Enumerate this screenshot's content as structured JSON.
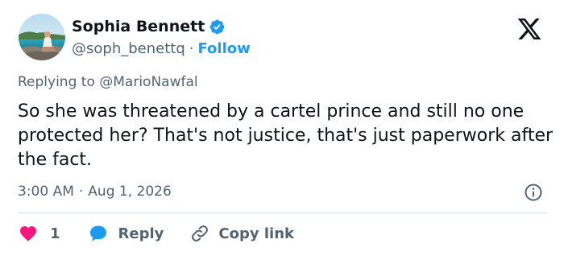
{
  "author": {
    "name": "Sophia Bennett",
    "handle": "@soph_benettq",
    "separator": "·",
    "follow_label": "Follow",
    "avatar_icon": "beach-photo-avatar",
    "verified_icon": "verified-badge-icon"
  },
  "brand": {
    "logo_icon": "x-logo-icon"
  },
  "reply_context": {
    "prefix": "Replying to",
    "mention": "@MarioNawfal"
  },
  "post": {
    "text": "So she was threatened by a cartel prince and still no one protected her? That's not justice, that's just paperwork after the fact.",
    "time": "3:00 AM",
    "separator": "·",
    "date": "Aug 1, 2026"
  },
  "actions": {
    "like_count": "1",
    "reply_label": "Reply",
    "copy_label": "Copy link"
  },
  "colors": {
    "accent": "#1d9bf0",
    "like": "#f91880",
    "text": "#0f1419",
    "muted": "#536471",
    "divider": "#cfd9de"
  }
}
